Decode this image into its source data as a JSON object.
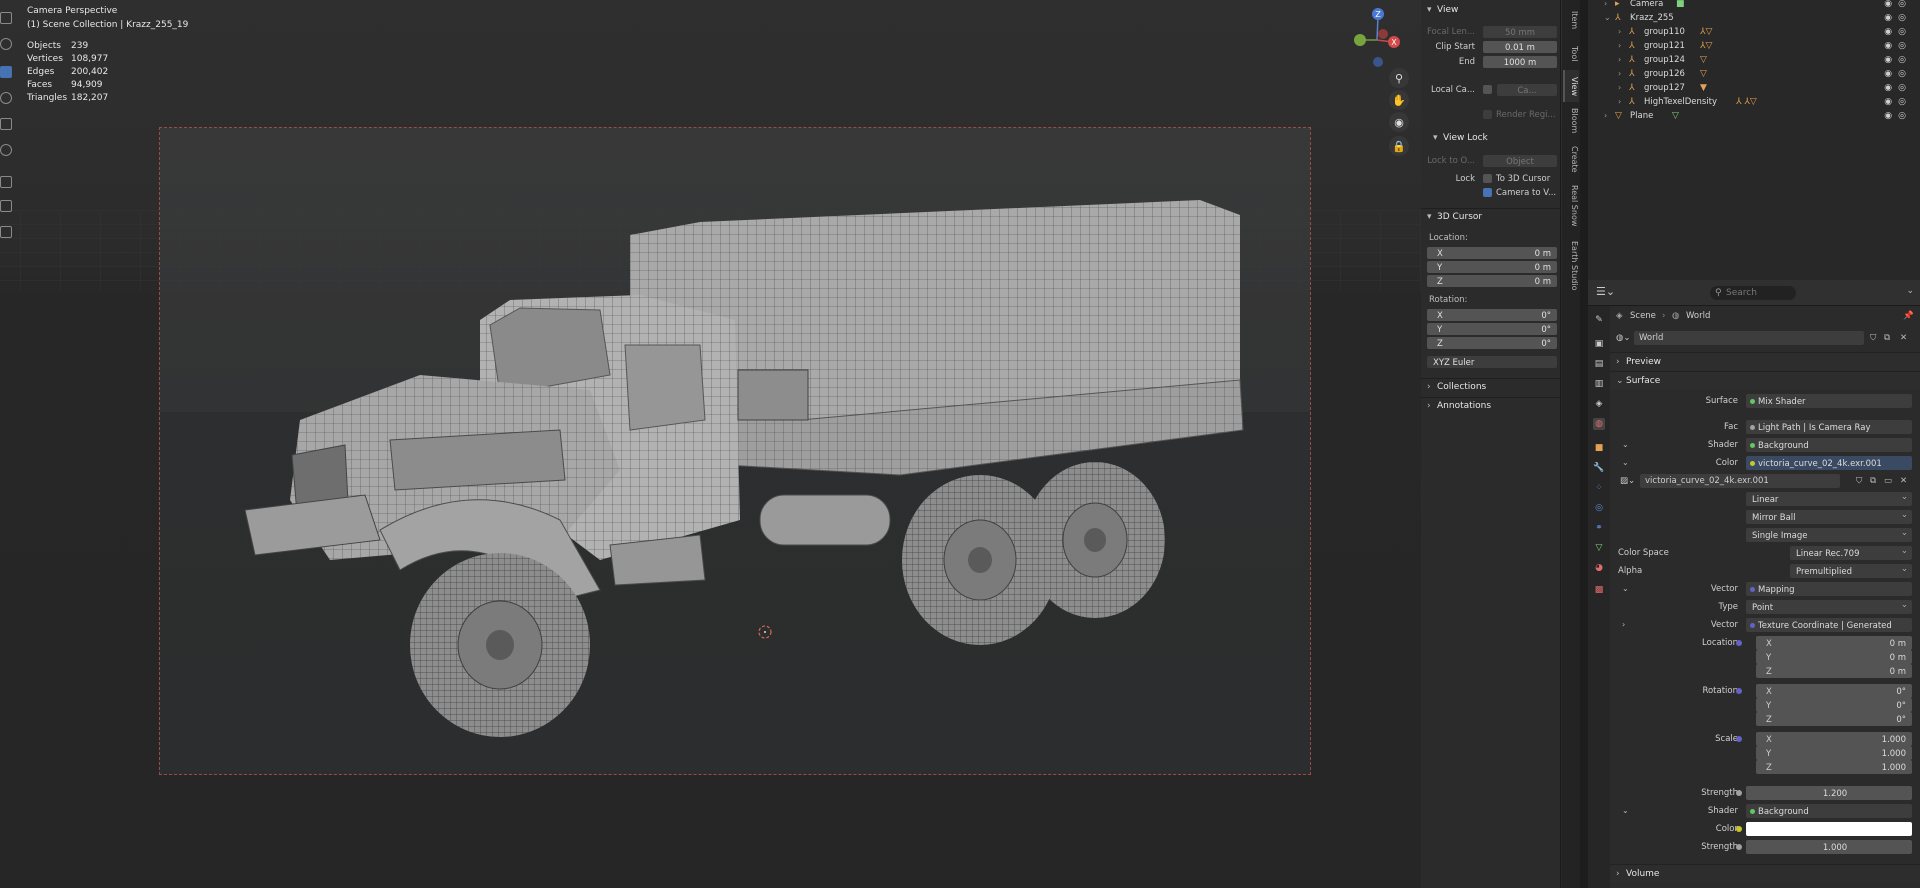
{
  "viewport": {
    "mode": "Camera Perspective",
    "collection": "(1) Scene Collection | Krazz_255_19",
    "stats": [
      {
        "label": "Objects",
        "value": "239"
      },
      {
        "label": "Vertices",
        "value": "108,977"
      },
      {
        "label": "Edges",
        "value": "200,402"
      },
      {
        "label": "Faces",
        "value": "94,909"
      },
      {
        "label": "Triangles",
        "value": "182,207"
      }
    ],
    "gizmo": {
      "z": "Z",
      "x": "X",
      "y": "Y"
    }
  },
  "npanel": {
    "view": {
      "title": "View",
      "focal_label": "Focal Len...",
      "focal_value": "50 mm",
      "clip_start_label": "Clip Start",
      "clip_start_value": "0.01 m",
      "end_label": "End",
      "end_value": "1000 m",
      "local_cam_label": "Local Ca...",
      "local_cam_value": "Ca...",
      "render_region": "Render Regi...",
      "view_lock": "View Lock",
      "lock_to_label": "Lock to O...",
      "lock_to_value": "Object",
      "lock_label": "Lock",
      "to_cursor": "To 3D Cursor",
      "camera_to_view": "Camera to V..."
    },
    "cursor": {
      "title": "3D Cursor",
      "location": "Location:",
      "rotation": "Rotation:",
      "loc": [
        {
          "axis": "X",
          "value": "0 m"
        },
        {
          "axis": "Y",
          "value": "0 m"
        },
        {
          "axis": "Z",
          "value": "0 m"
        }
      ],
      "rot": [
        {
          "axis": "X",
          "value": "0°"
        },
        {
          "axis": "Y",
          "value": "0°"
        },
        {
          "axis": "Z",
          "value": "0°"
        }
      ],
      "mode": "XYZ Euler"
    },
    "collections": "Collections",
    "annotations": "Annotations",
    "tabs": [
      "Item",
      "Tool",
      "View",
      "Bloom",
      "Create",
      "Real Snow",
      "Earth Studio"
    ]
  },
  "outliner": {
    "rows": [
      {
        "name": "Camera",
        "indent": 1
      },
      {
        "name": "Krazz_255",
        "indent": 0
      },
      {
        "name": "group110",
        "indent": 2
      },
      {
        "name": "group121",
        "indent": 2
      },
      {
        "name": "group124",
        "indent": 2
      },
      {
        "name": "group126",
        "indent": 2
      },
      {
        "name": "group127",
        "indent": 2
      },
      {
        "name": "HighTexelDensity",
        "indent": 2
      },
      {
        "name": "Plane",
        "indent": 1
      }
    ]
  },
  "properties": {
    "search_placeholder": "Search",
    "breadcrumb": {
      "scene": "Scene",
      "world": "World"
    },
    "world_name": "World",
    "preview": "Preview",
    "surface": "Surface",
    "surface_shader": "Mix Shader",
    "fac_label": "Fac",
    "fac_value": "Light Path | Is Camera Ray",
    "shader1_label": "Shader",
    "shader1_value": "Background",
    "color_label": "Color",
    "color_value": "victoria_curve_02_4k.exr.001",
    "image_name": "victoria_curve_02_4k.exr.001",
    "interp": "Linear",
    "projection": "Mirror Ball",
    "source": "Single Image",
    "color_space_label": "Color Space",
    "color_space_value": "Linear Rec.709",
    "alpha_label": "Alpha",
    "alpha_value": "Premultiplied",
    "vector_label": "Vector",
    "vector_value": "Mapping",
    "type_label": "Type",
    "type_value": "Point",
    "vector2_label": "Vector",
    "vector2_value": "Texture Coordinate | Generated",
    "location_label": "Location",
    "location": [
      {
        "axis": "X",
        "value": "0 m"
      },
      {
        "axis": "Y",
        "value": "0 m"
      },
      {
        "axis": "Z",
        "value": "0 m"
      }
    ],
    "rotation_label": "Rotation",
    "rotation": [
      {
        "axis": "X",
        "value": "0°"
      },
      {
        "axis": "Y",
        "value": "0°"
      },
      {
        "axis": "Z",
        "value": "0°"
      }
    ],
    "scale_label": "Scale",
    "scale": [
      {
        "axis": "X",
        "value": "1.000"
      },
      {
        "axis": "Y",
        "value": "1.000"
      },
      {
        "axis": "Z",
        "value": "1.000"
      }
    ],
    "strength_label": "Strength",
    "strength_value": "1.200",
    "shader2_label": "Shader",
    "shader2_value": "Background",
    "color2_label": "Color",
    "color2_hex": "#ffffff",
    "strength2_label": "Strength",
    "strength2_value": "1.000",
    "volume": "Volume"
  }
}
